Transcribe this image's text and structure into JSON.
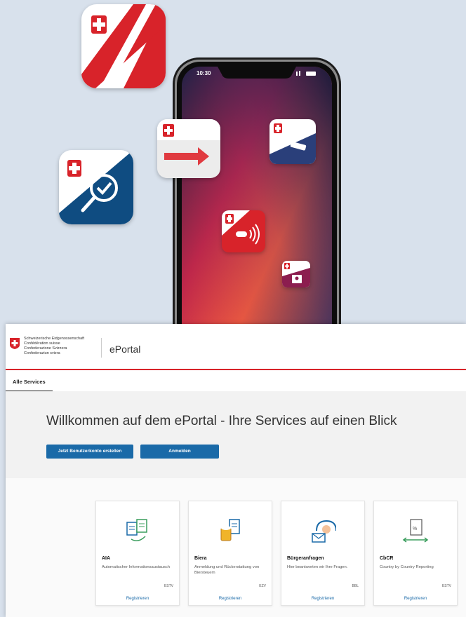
{
  "phone": {
    "time": "10:30"
  },
  "portal": {
    "org_names": [
      "Schweizerische Eidgenossenschaft",
      "Confédération suisse",
      "Confederazione Svizzera",
      "Confederaziun svizra"
    ],
    "title": "ePortal",
    "tab": "Alle Services",
    "welcome": "Willkommen auf dem ePortal - Ihre Services auf einen Blick",
    "btn_create": "Jetzt Benutzerkonto erstellen",
    "btn_login": "Anmelden"
  },
  "cards": [
    {
      "title": "AIA",
      "desc": "Automatischer Informationsaustausch",
      "org": "ESTV",
      "action": "Registrieren",
      "icon": "document-exchange-icon"
    },
    {
      "title": "Biera",
      "desc": "Anmeldung und Rückerstattung von Biersteuern",
      "org": "EZV",
      "action": "Registrieren",
      "icon": "beer-document-icon"
    },
    {
      "title": "Bürgeranfragen",
      "desc": "Hier beantworten wir Ihre Fragen.",
      "org": "BBL",
      "action": "Registrieren",
      "icon": "headset-mail-icon"
    },
    {
      "title": "CbCR",
      "desc": "Country by Country Reporting",
      "org": "ESTV",
      "action": "Registrieren",
      "icon": "tax-document-arrows-icon"
    }
  ],
  "colors": {
    "swiss_red": "#d8232a",
    "brand_blue": "#1a6aa8",
    "dark_blue": "#0f4c81"
  }
}
